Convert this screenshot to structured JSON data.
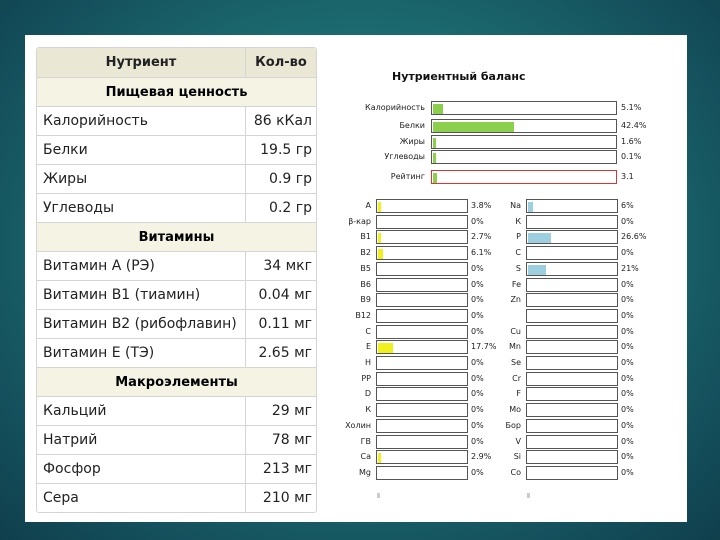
{
  "table": {
    "header": {
      "nutrient": "Нутриент",
      "amount": "Кол-во"
    },
    "sections": [
      {
        "title": "Пищевая ценность",
        "rows": [
          {
            "name": "Калорийность",
            "value": "86 кКал"
          },
          {
            "name": "Белки",
            "value": "19.5 гр"
          },
          {
            "name": "Жиры",
            "value": "0.9 гр"
          },
          {
            "name": "Углеводы",
            "value": "0.2 гр"
          }
        ]
      },
      {
        "title": "Витамины",
        "rows": [
          {
            "name": "Витамин А (РЭ)",
            "value": "34 мкг"
          },
          {
            "name": "Витамин В1 (тиамин)",
            "value": "0.04 мг"
          },
          {
            "name": "Витамин В2 (рибофлавин)",
            "value": "0.11 мг"
          },
          {
            "name": "Витамин Е (ТЭ)",
            "value": "2.65 мг"
          }
        ]
      },
      {
        "title": "Макроэлементы",
        "rows": [
          {
            "name": "Кальций",
            "value": "29 мг"
          },
          {
            "name": "Натрий",
            "value": "78 мг"
          },
          {
            "name": "Фосфор",
            "value": "213 мг"
          },
          {
            "name": "Сера",
            "value": "210 мг"
          }
        ]
      }
    ]
  },
  "balance": {
    "title": "Нутриентный баланс",
    "summary": [
      {
        "label": "Калорийность",
        "pct": "5.1%",
        "fraction": 0.051
      },
      {
        "label": "Белки",
        "pct": "42.4%",
        "fraction": 0.424
      },
      {
        "label": "Жиры",
        "pct": "1.6%",
        "fraction": 0.016
      },
      {
        "label": "Углеводы",
        "pct": "0.1%",
        "fraction": 0.001
      }
    ],
    "rating": {
      "label": "Рейтинг",
      "value": "3.1",
      "fraction": 0.031
    },
    "vitamins": [
      {
        "label": "А",
        "pct": "3.8%",
        "fraction": 0.038
      },
      {
        "label": "β-кар",
        "pct": "0%",
        "fraction": 0
      },
      {
        "label": "В1",
        "pct": "2.7%",
        "fraction": 0.027
      },
      {
        "label": "В2",
        "pct": "6.1%",
        "fraction": 0.061
      },
      {
        "label": "В5",
        "pct": "0%",
        "fraction": 0
      },
      {
        "label": "В6",
        "pct": "0%",
        "fraction": 0
      },
      {
        "label": "В9",
        "pct": "0%",
        "fraction": 0
      },
      {
        "label": "В12",
        "pct": "0%",
        "fraction": 0
      },
      {
        "label": "С",
        "pct": "0%",
        "fraction": 0
      },
      {
        "label": "Е",
        "pct": "17.7%",
        "fraction": 0.177
      },
      {
        "label": "Н",
        "pct": "0%",
        "fraction": 0
      },
      {
        "label": "РР",
        "pct": "0%",
        "fraction": 0
      },
      {
        "label": "D",
        "pct": "0%",
        "fraction": 0
      },
      {
        "label": "К",
        "pct": "0%",
        "fraction": 0
      },
      {
        "label": "Холин",
        "pct": "0%",
        "fraction": 0
      },
      {
        "label": "ГВ",
        "pct": "0%",
        "fraction": 0
      },
      {
        "label": "Са",
        "pct": "2.9%",
        "fraction": 0.029
      },
      {
        "label": "Mg",
        "pct": "0%",
        "fraction": 0
      }
    ],
    "minerals": [
      {
        "label": "Na",
        "pct": "6%",
        "fraction": 0.06
      },
      {
        "label": "К",
        "pct": "0%",
        "fraction": 0
      },
      {
        "label": "Р",
        "pct": "26.6%",
        "fraction": 0.266
      },
      {
        "label": "С",
        "pct": "0%",
        "fraction": 0
      },
      {
        "label": "S",
        "pct": "21%",
        "fraction": 0.21
      },
      {
        "label": "Fe",
        "pct": "0%",
        "fraction": 0
      },
      {
        "label": "Zn",
        "pct": "0%",
        "fraction": 0
      },
      {
        "label": "",
        "pct": "0%",
        "fraction": 0
      },
      {
        "label": "Cu",
        "pct": "0%",
        "fraction": 0
      },
      {
        "label": "Mn",
        "pct": "0%",
        "fraction": 0
      },
      {
        "label": "Se",
        "pct": "0%",
        "fraction": 0
      },
      {
        "label": "Cr",
        "pct": "0%",
        "fraction": 0
      },
      {
        "label": "F",
        "pct": "0%",
        "fraction": 0
      },
      {
        "label": "Mo",
        "pct": "0%",
        "fraction": 0
      },
      {
        "label": "Бор",
        "pct": "0%",
        "fraction": 0
      },
      {
        "label": "V",
        "pct": "0%",
        "fraction": 0
      },
      {
        "label": "Si",
        "pct": "0%",
        "fraction": 0
      },
      {
        "label": "Co",
        "pct": "0%",
        "fraction": 0
      }
    ],
    "colors": {
      "summary": "#8ccf4d",
      "vitamin": "#f0f01e",
      "mineral": "#9dcfe0",
      "rating_border": "#d33333"
    }
  }
}
